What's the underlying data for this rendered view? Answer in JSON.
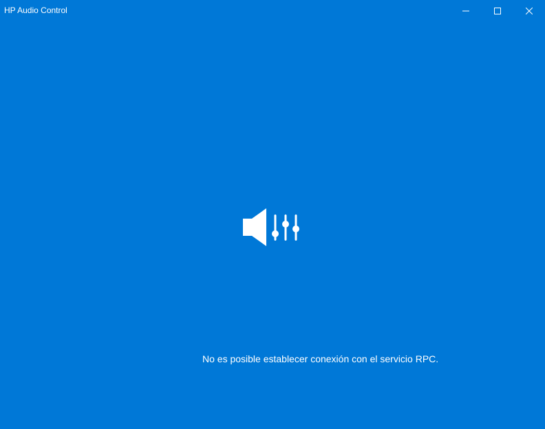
{
  "window": {
    "title": "HP Audio Control",
    "background_color": "#0078d7",
    "controls": [
      "minimize",
      "maximize",
      "close"
    ]
  },
  "main": {
    "logo_icon": "speaker-equalizer-icon",
    "message": "No es posible establecer conexión con el servicio RPC."
  }
}
